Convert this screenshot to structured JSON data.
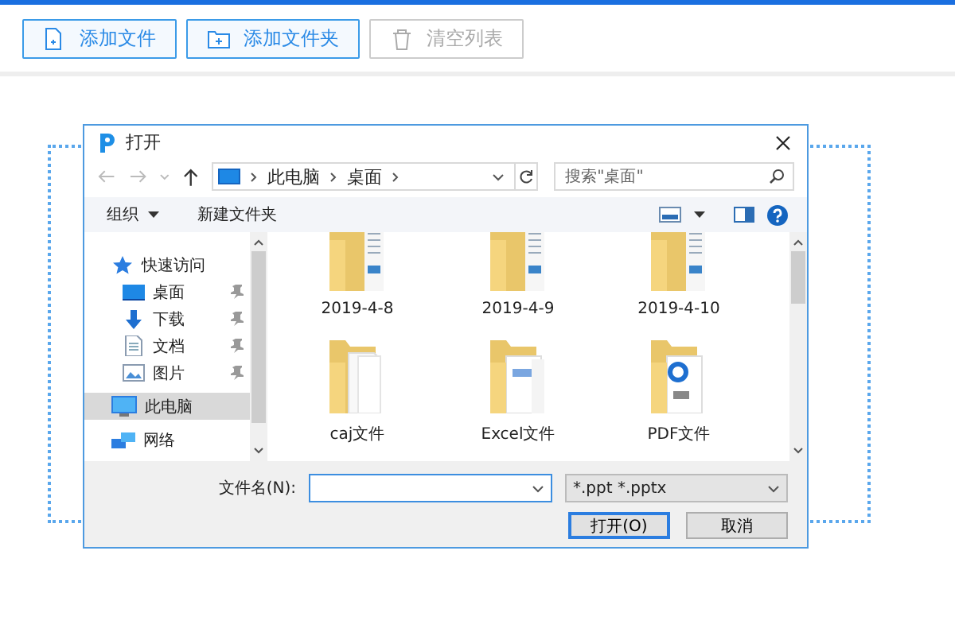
{
  "toolbar": [
    {
      "label": "添加文件",
      "kind": "file",
      "disabled": false
    },
    {
      "label": "添加文件夹",
      "kind": "folder",
      "disabled": false
    },
    {
      "label": "清空列表",
      "kind": "trash",
      "disabled": true
    }
  ],
  "dialog": {
    "title": "打开",
    "address": {
      "segments": [
        "此电脑",
        "桌面"
      ]
    },
    "search": {
      "placeholder": "搜索\"桌面\""
    },
    "commands": {
      "organize": "组织",
      "new_folder": "新建文件夹"
    },
    "nav": [
      {
        "label": "快速访问",
        "kind": "star",
        "selected": false,
        "children": [
          {
            "label": "桌面",
            "kind": "desktop",
            "pinned": true,
            "selected": false
          },
          {
            "label": "下载",
            "kind": "download",
            "pinned": true,
            "selected": false
          },
          {
            "label": "文档",
            "kind": "document",
            "pinned": true,
            "selected": false
          },
          {
            "label": "图片",
            "kind": "pictures",
            "pinned": true,
            "selected": false
          }
        ]
      },
      {
        "label": "此电脑",
        "kind": "computer",
        "selected": true
      },
      {
        "label": "网络",
        "kind": "network",
        "selected": false
      }
    ],
    "files": [
      {
        "name": "2019-4-8",
        "kind": "images"
      },
      {
        "name": "2019-4-9",
        "kind": "images"
      },
      {
        "name": "2019-4-10",
        "kind": "images"
      },
      {
        "name": "caj文件",
        "kind": "plain"
      },
      {
        "name": "Excel文件",
        "kind": "sheet"
      },
      {
        "name": "PDF文件",
        "kind": "pdf"
      }
    ],
    "filename": {
      "label": "文件名(N):"
    },
    "filter": "*.ppt *.pptx",
    "buttons": [
      {
        "label": "打开(O)",
        "default": true
      },
      {
        "label": "取消",
        "default": false
      }
    ]
  }
}
